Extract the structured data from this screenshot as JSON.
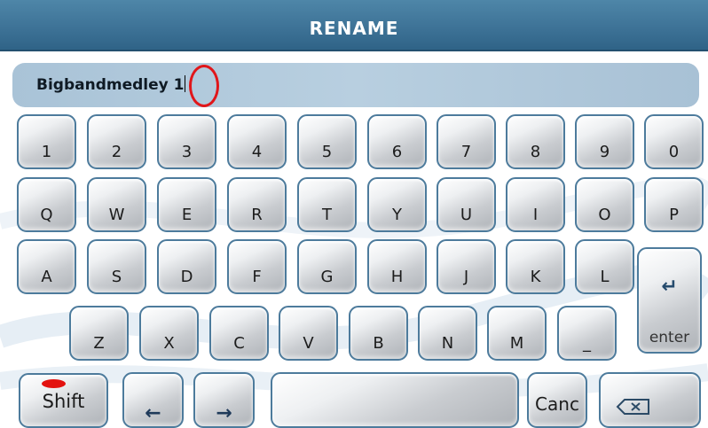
{
  "title": "RENAME",
  "field": {
    "value": "Bigbandmedley 1"
  },
  "rows": [
    [
      "1",
      "2",
      "3",
      "4",
      "5",
      "6",
      "7",
      "8",
      "9",
      "0"
    ],
    [
      "Q",
      "W",
      "E",
      "R",
      "T",
      "Y",
      "U",
      "I",
      "O",
      "P"
    ],
    [
      "A",
      "S",
      "D",
      "F",
      "G",
      "H",
      "J",
      "K",
      "L"
    ],
    [
      "Z",
      "X",
      "C",
      "V",
      "B",
      "N",
      "M",
      "_"
    ]
  ],
  "keys": {
    "enter": "enter",
    "enter_icon": "↵",
    "shift": "Shift",
    "cancel": "Canc",
    "left_icon": "←",
    "right_icon": "→",
    "backspace_icon": "backspace-icon"
  },
  "colors": {
    "title_bar": "#3e7397",
    "key_border": "#4d7b9c",
    "field_bg": "#b8cfe0",
    "highlight": "#e0161a"
  }
}
